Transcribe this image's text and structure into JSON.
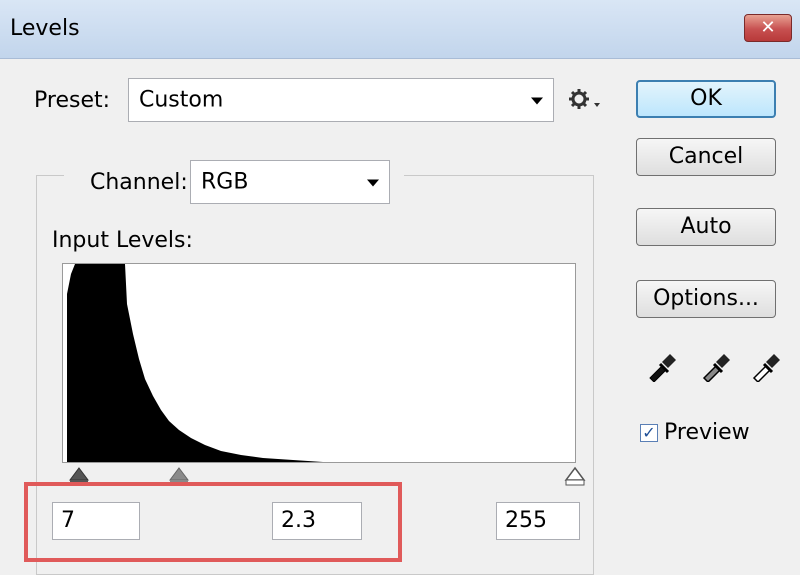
{
  "window": {
    "title": "Levels",
    "close_glyph": "✕"
  },
  "preset": {
    "label": "Preset:",
    "value": "Custom"
  },
  "channel": {
    "label": "Channel:",
    "value": "RGB"
  },
  "input_levels": {
    "label": "Input Levels:",
    "black": "7",
    "gamma": "2.3",
    "white": "255"
  },
  "buttons": {
    "ok": "OK",
    "cancel": "Cancel",
    "auto": "Auto",
    "options": "Options..."
  },
  "preview": {
    "label": "Preview",
    "checked": true,
    "check_glyph": "✓"
  },
  "eyedroppers": [
    "black-point-eyedropper-icon",
    "gray-point-eyedropper-icon",
    "white-point-eyedropper-icon"
  ],
  "colors": {
    "highlight": "#e05a5a",
    "ok_border": "#3c7fb1",
    "close": "#c75050"
  }
}
